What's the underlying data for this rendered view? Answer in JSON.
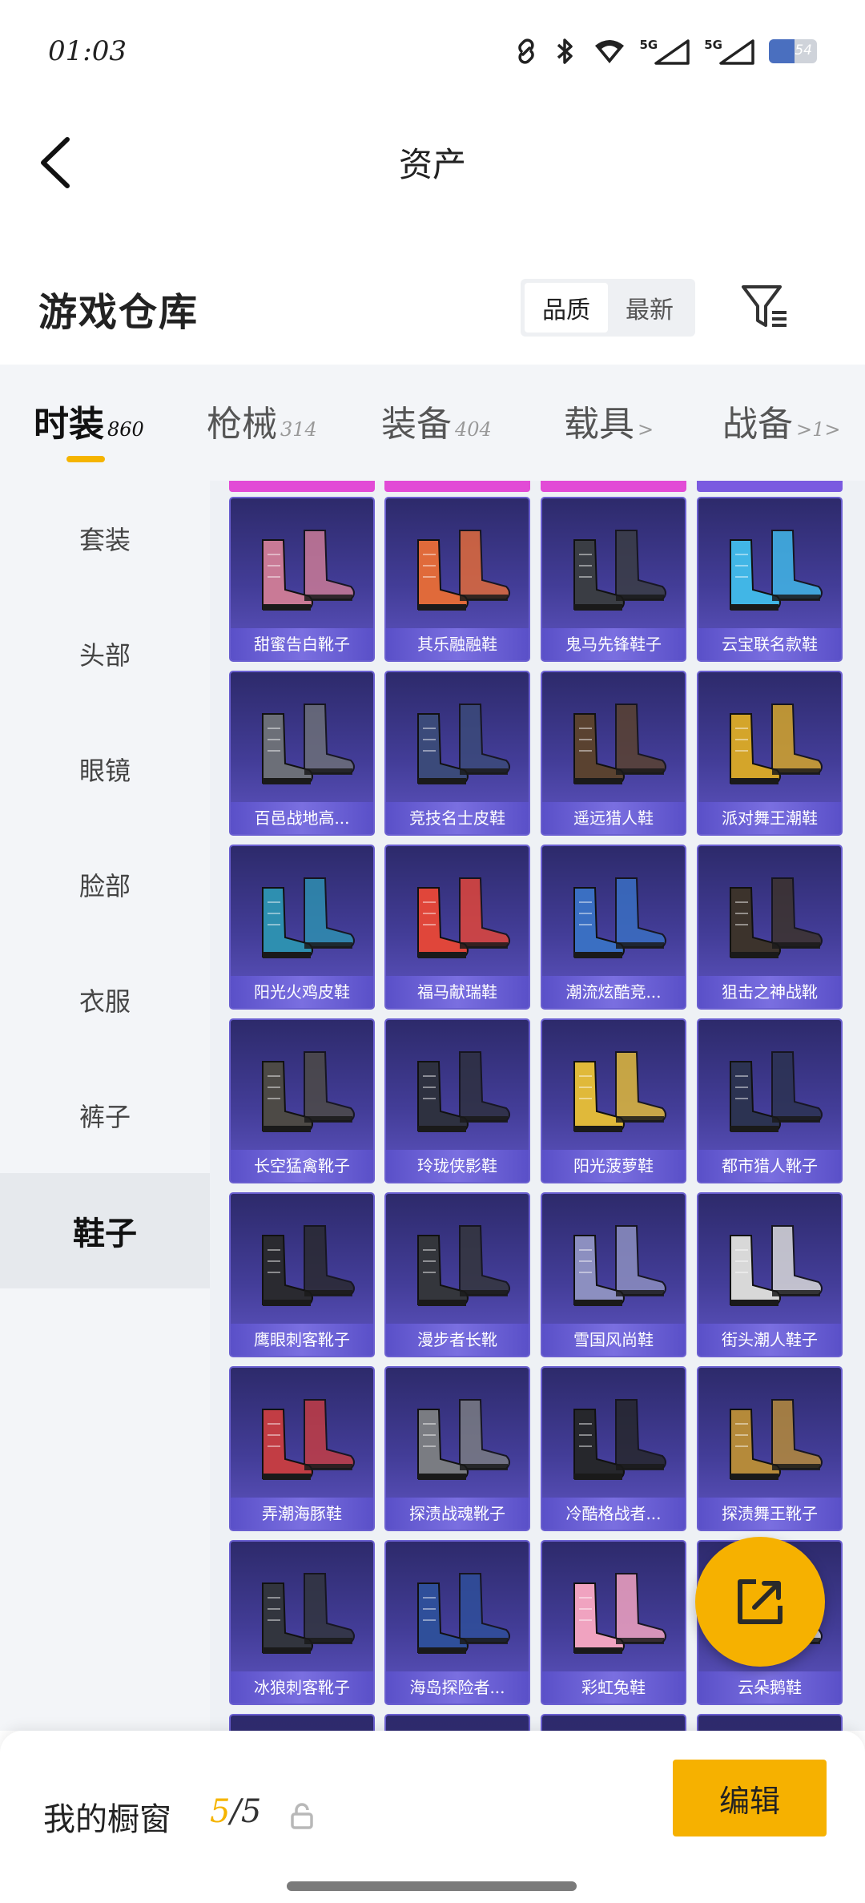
{
  "status_bar": {
    "time": "01:03",
    "battery_level": "54",
    "battery_fraction": 0.54,
    "signal_labels": [
      "5G",
      "5G"
    ]
  },
  "header": {
    "title": "资产"
  },
  "warehouse": {
    "title": "游戏仓库",
    "sort_options": [
      "品质",
      "最新"
    ],
    "active_sort": "品质"
  },
  "tabs": [
    {
      "label": "时装",
      "count": "860",
      "active": true
    },
    {
      "label": "枪械",
      "count": "314",
      "active": false
    },
    {
      "label": "装备",
      "count": "404",
      "active": false
    },
    {
      "label": "载具",
      "count": ">",
      "active": false
    },
    {
      "label": "战备",
      "count": ">1>",
      "active": false
    }
  ],
  "sidebar": {
    "items": [
      {
        "label": "套装"
      },
      {
        "label": "头部"
      },
      {
        "label": "眼镜"
      },
      {
        "label": "脸部"
      },
      {
        "label": "衣服"
      },
      {
        "label": "裤子"
      },
      {
        "label": "鞋子",
        "active": true
      }
    ]
  },
  "items": [
    {
      "name": "甜蜜告白靴子",
      "color": "#c97a96"
    },
    {
      "name": "其乐融融鞋",
      "color": "#e06a3a"
    },
    {
      "name": "鬼马先锋鞋子",
      "color": "#3a3d44"
    },
    {
      "name": "云宝联名款鞋",
      "color": "#41b6e6"
    },
    {
      "name": "百邑战地高...",
      "color": "#6c6f78"
    },
    {
      "name": "竞技名士皮鞋",
      "color": "#3b4a7a"
    },
    {
      "name": "遥远猎人鞋",
      "color": "#5a4230"
    },
    {
      "name": "派对舞王潮鞋",
      "color": "#d4a52a"
    },
    {
      "name": "阳光火鸡皮鞋",
      "color": "#2e8fb0"
    },
    {
      "name": "福马献瑞鞋",
      "color": "#e0463a"
    },
    {
      "name": "潮流炫酷竞...",
      "color": "#3a6fc2"
    },
    {
      "name": "狙击之神战靴",
      "color": "#3c332c"
    },
    {
      "name": "长空猛禽靴子",
      "color": "#4d4a46"
    },
    {
      "name": "玲珑侠影鞋",
      "color": "#2e3140"
    },
    {
      "name": "阳光菠萝鞋",
      "color": "#e0b93a"
    },
    {
      "name": "都市猎人靴子",
      "color": "#2c3352"
    },
    {
      "name": "鹰眼刺客靴子",
      "color": "#2a2a30"
    },
    {
      "name": "漫步者长靴",
      "color": "#34363c"
    },
    {
      "name": "雪国风尚鞋",
      "color": "#8c8fc0"
    },
    {
      "name": "街头潮人鞋子",
      "color": "#d8d8d8"
    },
    {
      "name": "弄潮海豚鞋",
      "color": "#c23d44"
    },
    {
      "name": "探渍战魂靴子",
      "color": "#7a7c82"
    },
    {
      "name": "冷酷格战者...",
      "color": "#26272c"
    },
    {
      "name": "探渍舞王靴子",
      "color": "#b58a3a"
    },
    {
      "name": "冰狼刺客靴子",
      "color": "#32353e"
    },
    {
      "name": "海岛探险者...",
      "color": "#2f4f9a"
    },
    {
      "name": "彩虹兔鞋",
      "color": "#f0a3c0"
    },
    {
      "name": "云朵鹅鞋",
      "color": "#e8e8ee"
    }
  ],
  "top_strip_colors": [
    "#e24bd6",
    "#e24bd6",
    "#e24bd6",
    "#7a5ae0"
  ],
  "bottom_bar": {
    "showcase_label": "我的橱窗",
    "showcase_current": "5",
    "showcase_total": "/5",
    "edit_label": "编辑"
  },
  "colors": {
    "accent": "#f5b400",
    "card_bg": "#3f3a92"
  }
}
